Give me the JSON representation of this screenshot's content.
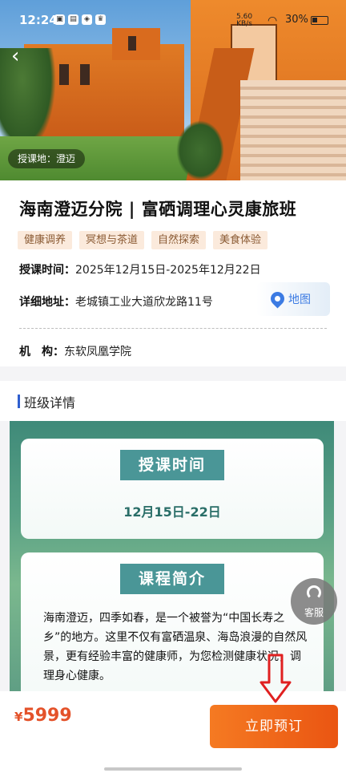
{
  "status_bar": {
    "time": "12:24",
    "network_speed": "5.60\nKB/s",
    "battery": "30%"
  },
  "hero": {
    "location_tag": "授课地：澄迈"
  },
  "course": {
    "title": "海南澄迈分院 | 富硒调理心灵康旅班",
    "tags": [
      "健康调养",
      "冥想与茶道",
      "自然探索",
      "美食体验"
    ],
    "time_label": "授课时间：",
    "time_value": "2025年12月15日-2025年12月22日",
    "address_label": "详细地址：",
    "address_value": "老城镇工业大道欣龙路11号",
    "map_label": "地图",
    "org_label": "机　构：",
    "org_value": "东软凤凰学院"
  },
  "section": {
    "title": "班级详情"
  },
  "detail": {
    "time_heading": "授课时间",
    "time_text": "12月15日-22日",
    "intro_heading": "课程简介",
    "intro_text": "海南澄迈，四季如春，是一个被誉为“中国长寿之乡”的地方。这里不仅有富硒温泉、海岛浪漫的自然风景，更有经验丰富的健康师，为您检测健康状况，调理身心健康。"
  },
  "floating": {
    "customer_service": "客服"
  },
  "footer": {
    "currency": "¥",
    "price": "5999",
    "book_label": "立即预订"
  },
  "colors": {
    "accent": "#ea5512",
    "price": "#e4522a",
    "pill": "#4a9697",
    "section_bar": "#2f5fcf"
  }
}
